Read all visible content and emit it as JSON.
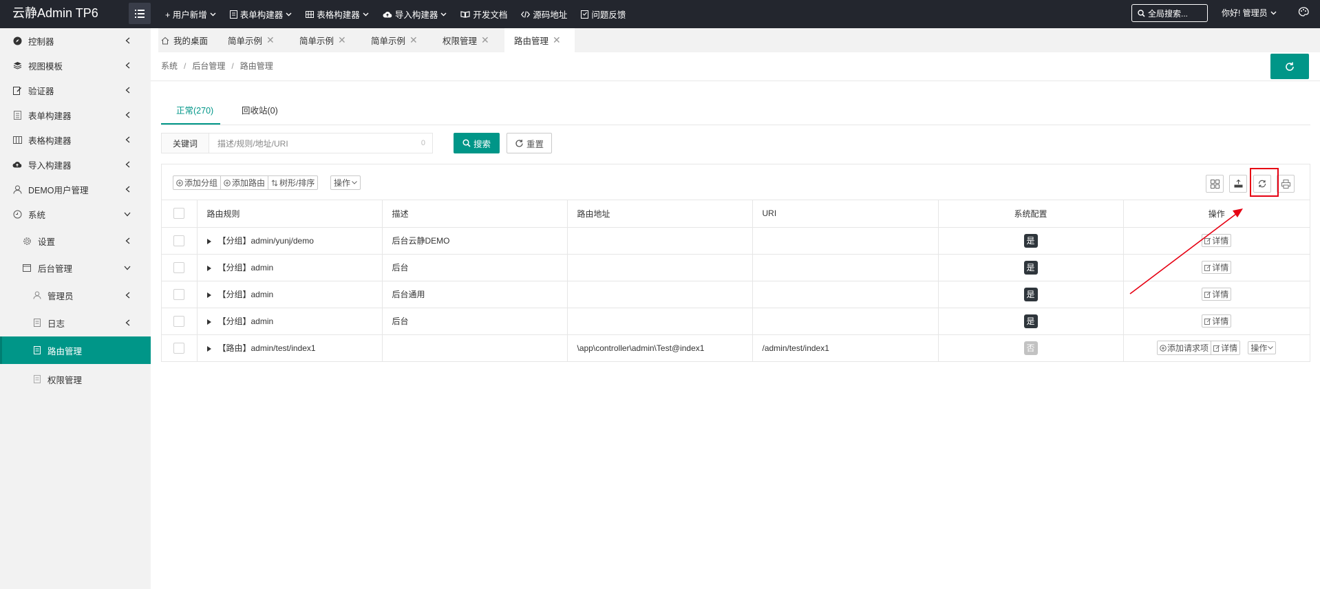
{
  "app": {
    "brand": "云静Admin TP6"
  },
  "topnav": [
    {
      "icon": "plus-icon",
      "label": "+ 用户新增",
      "caret": true
    },
    {
      "icon": "form-icon",
      "label": "表单构建器",
      "caret": true
    },
    {
      "icon": "table-icon",
      "label": "表格构建器",
      "caret": true
    },
    {
      "icon": "cloud-upload-icon",
      "label": "导入构建器",
      "caret": true
    },
    {
      "icon": "book-icon",
      "label": "开发文档",
      "caret": false
    },
    {
      "icon": "code-icon",
      "label": "源码地址",
      "caret": false
    },
    {
      "icon": "feedback-icon",
      "label": "问题反馈",
      "caret": false
    }
  ],
  "header": {
    "search_label": "全局搜索...",
    "user_label": "你好! 管理员"
  },
  "sidebar": {
    "items": [
      {
        "label": "控制器"
      },
      {
        "label": "视图模板"
      },
      {
        "label": "验证器"
      },
      {
        "label": "表单构建器"
      },
      {
        "label": "表格构建器"
      },
      {
        "label": "导入构建器"
      },
      {
        "label": "DEMO用户管理"
      },
      {
        "label": "系统"
      },
      {
        "label": "设置"
      },
      {
        "label": "后台管理"
      },
      {
        "label": "管理员"
      },
      {
        "label": "日志"
      },
      {
        "label": "路由管理"
      },
      {
        "label": "权限管理"
      }
    ]
  },
  "tabs": [
    {
      "label": "我的桌面"
    },
    {
      "label": "简单示例"
    },
    {
      "label": "简单示例"
    },
    {
      "label": "简单示例"
    },
    {
      "label": "权限管理"
    },
    {
      "label": "路由管理"
    }
  ],
  "breadcrumb": [
    "系统",
    "后台管理",
    "路由管理"
  ],
  "content_tabs": [
    {
      "label": "正常(270)"
    },
    {
      "label": "回收站(0)"
    }
  ],
  "search": {
    "label": "关键词",
    "placeholder": "描述/规则/地址/URI",
    "count": "0",
    "search_button": "搜索",
    "reset_button": "重置"
  },
  "toolbar": {
    "add_group": "添加分组",
    "add_route": "添加路由",
    "tree_sort": "树形/排序",
    "ops": "操作"
  },
  "table": {
    "columns": [
      "路由规则",
      "描述",
      "路由地址",
      "URI",
      "系统配置",
      "操作"
    ],
    "rows": [
      {
        "rule": "【分组】admin/yunj/demo",
        "desc": "后台云静DEMO",
        "addr": "",
        "uri": "",
        "sys": "是"
      },
      {
        "rule": "【分组】admin",
        "desc": "后台",
        "addr": "",
        "uri": "",
        "sys": "是"
      },
      {
        "rule": "【分组】admin",
        "desc": "后台通用",
        "addr": "",
        "uri": "",
        "sys": "是"
      },
      {
        "rule": "【分组】admin",
        "desc": "后台",
        "addr": "",
        "uri": "",
        "sys": "是"
      },
      {
        "rule": "【路由】admin/test/index1",
        "desc": "",
        "addr": "\\app\\controller\\admin\\Test@index1",
        "uri": "/admin/test/index1",
        "sys": "否"
      }
    ],
    "detail_label": "详情",
    "add_request_label": "添加请求项",
    "row_ops_label": "操作"
  },
  "colors": {
    "accent": "#009688",
    "topbar": "#23262e",
    "annotation": "#e60012"
  }
}
